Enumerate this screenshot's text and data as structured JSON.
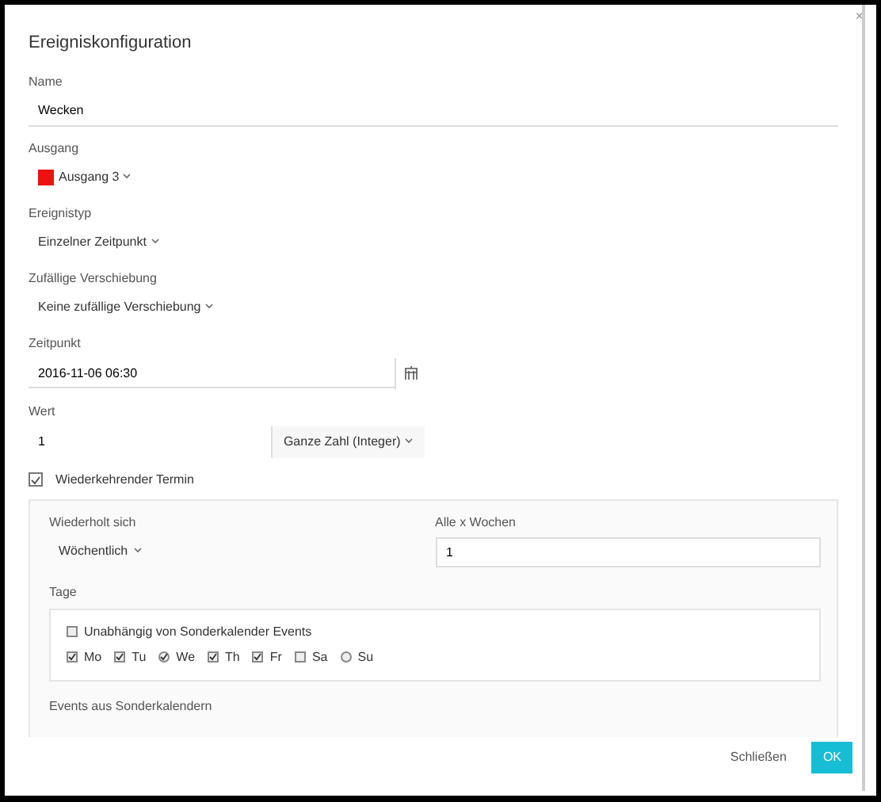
{
  "dialog": {
    "title": "Ereigniskonfiguration",
    "close": "×"
  },
  "fields": [
    {
      "kind": "input",
      "label": "Name",
      "value": "Wecken"
    },
    {
      "kind": "select",
      "label": "Ausgang",
      "value": "Ausgang 3",
      "color": "#ee1111"
    },
    {
      "kind": "select",
      "label": "Ereignistyp",
      "value": "Einzelner Zeitpunkt"
    },
    {
      "kind": "select",
      "label": "Zufällige Verschiebung",
      "value": "Keine zufällige Verschiebung"
    },
    {
      "kind": "date",
      "label": "Zeitpunkt",
      "value": "2016-11-06 06:30"
    },
    {
      "kind": "number",
      "label": "Wert",
      "value": "1",
      "unit": "Ganze Zahl (Integer)"
    }
  ],
  "recurring": {
    "label": "Wiederkehrender Termin",
    "checked": true
  },
  "recurrence": {
    "repeat_label": "Wiederholt sich",
    "repeat_value": "Wöchentlich",
    "every_label": "Alle x Wochen",
    "every_value": "1",
    "days_label": "Tage",
    "independent": {
      "label": "Unabhängig von Sonderkalender Events",
      "checked": false
    },
    "days": [
      {
        "label": "Mo",
        "kind": "checkbox",
        "checked": true
      },
      {
        "label": "Tu",
        "kind": "checkbox",
        "checked": true
      },
      {
        "label": "We",
        "kind": "radio",
        "checked": true
      },
      {
        "label": "Th",
        "kind": "checkbox",
        "checked": true
      },
      {
        "label": "Fr",
        "kind": "checkbox",
        "checked": true
      },
      {
        "label": "Sa",
        "kind": "checkbox",
        "checked": false
      },
      {
        "label": "Su",
        "kind": "radio",
        "checked": false
      }
    ],
    "events_label": "Events aus Sonderkalendern"
  },
  "buttons": [
    {
      "label": "Schließen",
      "kind": "link"
    },
    {
      "label": "OK",
      "kind": "primary"
    }
  ]
}
